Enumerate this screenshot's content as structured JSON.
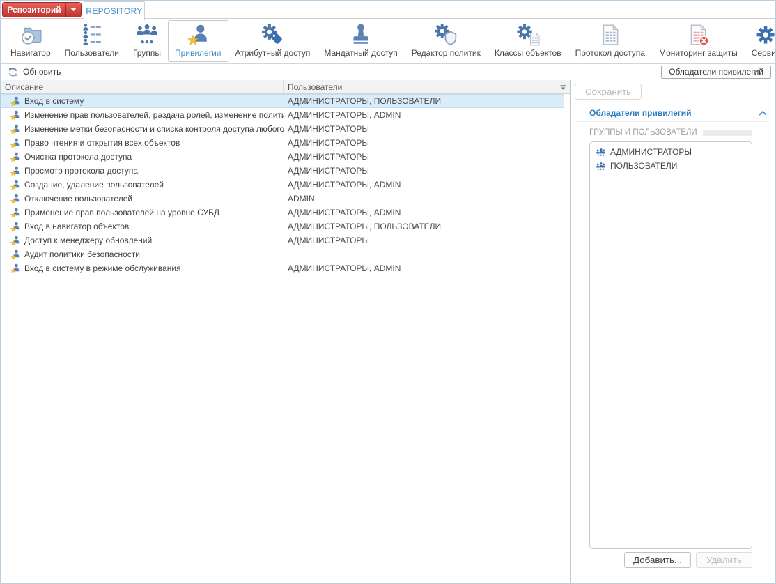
{
  "topbar": {
    "repo_button_label": "Репозиторий",
    "repo_button_icon": "caret-down-icon",
    "tab_label": "REPOSITORY"
  },
  "ribbon": {
    "items": [
      {
        "id": "navigator",
        "label": "Навигатор",
        "icon": "navigator-icon",
        "selected": false
      },
      {
        "id": "users",
        "label": "Пользователи",
        "icon": "users-icon",
        "selected": false
      },
      {
        "id": "groups",
        "label": "Группы",
        "icon": "groups-icon",
        "selected": false
      },
      {
        "id": "privileges",
        "label": "Привилегии",
        "icon": "privileges-icon",
        "selected": true
      },
      {
        "id": "attribute-access",
        "label": "Атрибутный доступ",
        "icon": "attr-access-icon",
        "selected": false
      },
      {
        "id": "mandatory-access",
        "label": "Мандатный доступ",
        "icon": "mandatory-icon",
        "selected": false
      },
      {
        "id": "policy-editor",
        "label": "Редактор политик",
        "icon": "policy-icon",
        "selected": false
      },
      {
        "id": "object-classes",
        "label": "Классы объектов",
        "icon": "classes-icon",
        "selected": false
      },
      {
        "id": "access-protocol",
        "label": "Протокол доступа",
        "icon": "protocol-icon",
        "selected": false
      },
      {
        "id": "security-monitoring",
        "label": "Мониторинг защиты",
        "icon": "monitoring-icon",
        "selected": false
      },
      {
        "id": "service",
        "label": "Сервис",
        "icon": "service-icon",
        "selected": false
      }
    ]
  },
  "toolbar": {
    "refresh_label": "Обновить",
    "refresh_icon": "refresh-icon",
    "holders_button_label": "Обладатели привилегий"
  },
  "table": {
    "columns": [
      "Описание",
      "Пользователи"
    ],
    "row_icon": "privilege-small-icon",
    "header_menu_icon": "header-menu-icon",
    "rows": [
      {
        "description": "Вход в систему",
        "users": "АДМИНИСТРАТОРЫ, ПОЛЬЗОВАТЕЛИ",
        "selected": true
      },
      {
        "description": "Изменение прав пользователей, раздача ролей, изменение политики",
        "users": "АДМИНИСТРАТОРЫ, ADMIN",
        "selected": false
      },
      {
        "description": "Изменение метки безопасности и списка контроля доступа любого ...",
        "users": "АДМИНИСТРАТОРЫ",
        "selected": false
      },
      {
        "description": "Право чтения и открытия всех объектов",
        "users": "АДМИНИСТРАТОРЫ",
        "selected": false
      },
      {
        "description": "Очистка протокола доступа",
        "users": "АДМИНИСТРАТОРЫ",
        "selected": false
      },
      {
        "description": "Просмотр протокола доступа",
        "users": "АДМИНИСТРАТОРЫ",
        "selected": false
      },
      {
        "description": "Создание, удаление пользователей",
        "users": "АДМИНИСТРАТОРЫ, ADMIN",
        "selected": false
      },
      {
        "description": "Отключение пользователей",
        "users": "ADMIN",
        "selected": false
      },
      {
        "description": "Применение прав пользователей на уровне СУБД",
        "users": "АДМИНИСТРАТОРЫ, ADMIN",
        "selected": false
      },
      {
        "description": "Вход в навигатор объектов",
        "users": "АДМИНИСТРАТОРЫ, ПОЛЬЗОВАТЕЛИ",
        "selected": false
      },
      {
        "description": "Доступ к менеджеру обновлений",
        "users": "АДМИНИСТРАТОРЫ",
        "selected": false
      },
      {
        "description": "Аудит политики безопасности",
        "users": "",
        "selected": false
      },
      {
        "description": "Вход в систему в режиме обслуживания",
        "users": "АДМИНИСТРАТОРЫ, ADMIN",
        "selected": false
      }
    ]
  },
  "panel": {
    "save_button_label": "Сохранить",
    "section_title": "Обладатели привилегий",
    "collapse_icon": "chevron-up-icon",
    "group_label": "ГРУППЫ И ПОЛЬЗОВАТЕЛИ",
    "member_icon": "group-small-icon",
    "members": [
      "АДМИНИСТРАТОРЫ",
      "ПОЛЬЗОВАТЕЛИ"
    ],
    "add_button_label": "Добавить...",
    "remove_button_label": "Удалить"
  },
  "colors": {
    "accent_blue": "#3f8fc9",
    "brand_red": "#c9302c",
    "selected_row_bg": "#d9ecf9",
    "icon_blue": "#4a76aa",
    "star_yellow": "#f3c231",
    "alert_red": "#d9534f"
  }
}
